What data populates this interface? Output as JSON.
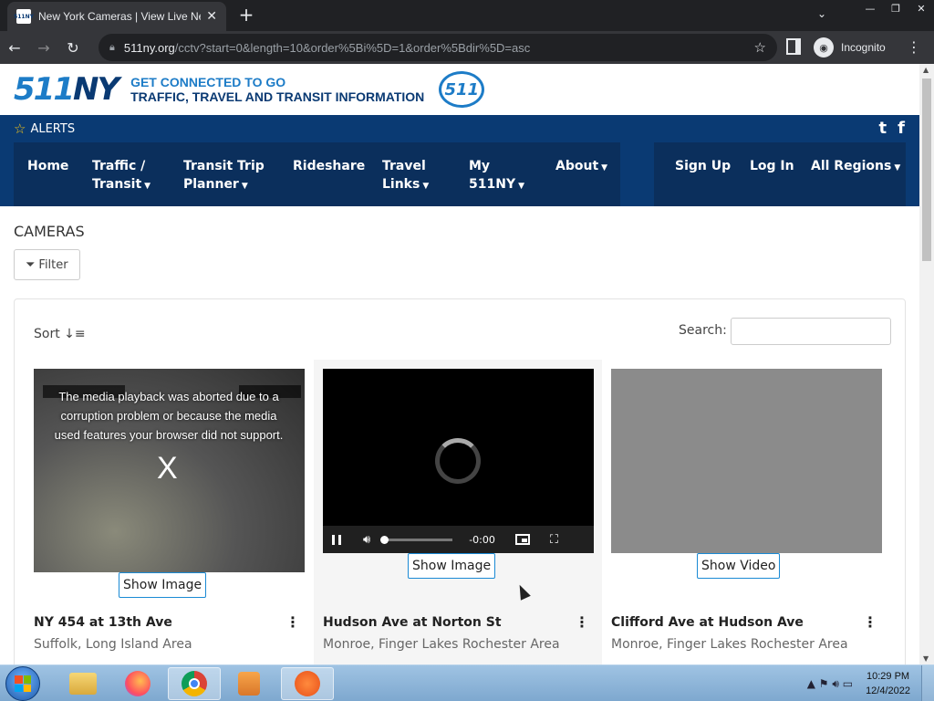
{
  "browser": {
    "tab_title": "New York Cameras | View Live Ne",
    "tab_favicon_text": "511NY",
    "url_host": "511ny.org",
    "url_path": "/cctv?start=0&length=10&order%5Bi%5D=1&order%5Bdir%5D=asc",
    "incognito_label": "Incognito"
  },
  "brand": {
    "logo_prefix": "511",
    "logo_suffix": "NY",
    "tagline_1": "GET CONNECTED TO GO",
    "tagline_2": "TRAFFIC, TRAVEL AND TRANSIT INFORMATION",
    "badge": "511"
  },
  "alerts": {
    "label": "ALERTS"
  },
  "social": {
    "twitter": "t",
    "facebook": "f"
  },
  "nav": {
    "home": "Home",
    "traffic_1": "Traffic /",
    "traffic_2": "Transit",
    "trip_1": "Transit Trip",
    "trip_2": "Planner",
    "rideshare": "Rideshare",
    "travel_1": "Travel",
    "travel_2": "Links",
    "my_1": "My",
    "my_2": "511NY",
    "about": "About",
    "signup": "Sign Up",
    "login": "Log In",
    "regions": "All Regions"
  },
  "page": {
    "title": "CAMERAS",
    "filter_label": "Filter",
    "sort_label": "Sort",
    "search_label": "Search:",
    "search_value": ""
  },
  "cameras": [
    {
      "error_text": "The media playback was aborted due to a corruption problem or because the media used features your browser did not support.",
      "x_mark": "X",
      "button": "Show Image",
      "title": "NY 454 at 13th Ave",
      "area": "Suffolk, Long Island Area"
    },
    {
      "time": "-0:00",
      "button": "Show Image",
      "title": "Hudson Ave at Norton St",
      "area": "Monroe, Finger Lakes Rochester Area"
    },
    {
      "button": "Show Video",
      "title": "Clifford Ave at Hudson Ave",
      "area": "Monroe, Finger Lakes Rochester Area"
    }
  ],
  "taskbar": {
    "time": "10:29 PM",
    "date": "12/4/2022"
  },
  "colors": {
    "nav_bg": "#0a3a73",
    "brand_blue": "#1d7cc7",
    "button_border": "#1a8ad4"
  }
}
